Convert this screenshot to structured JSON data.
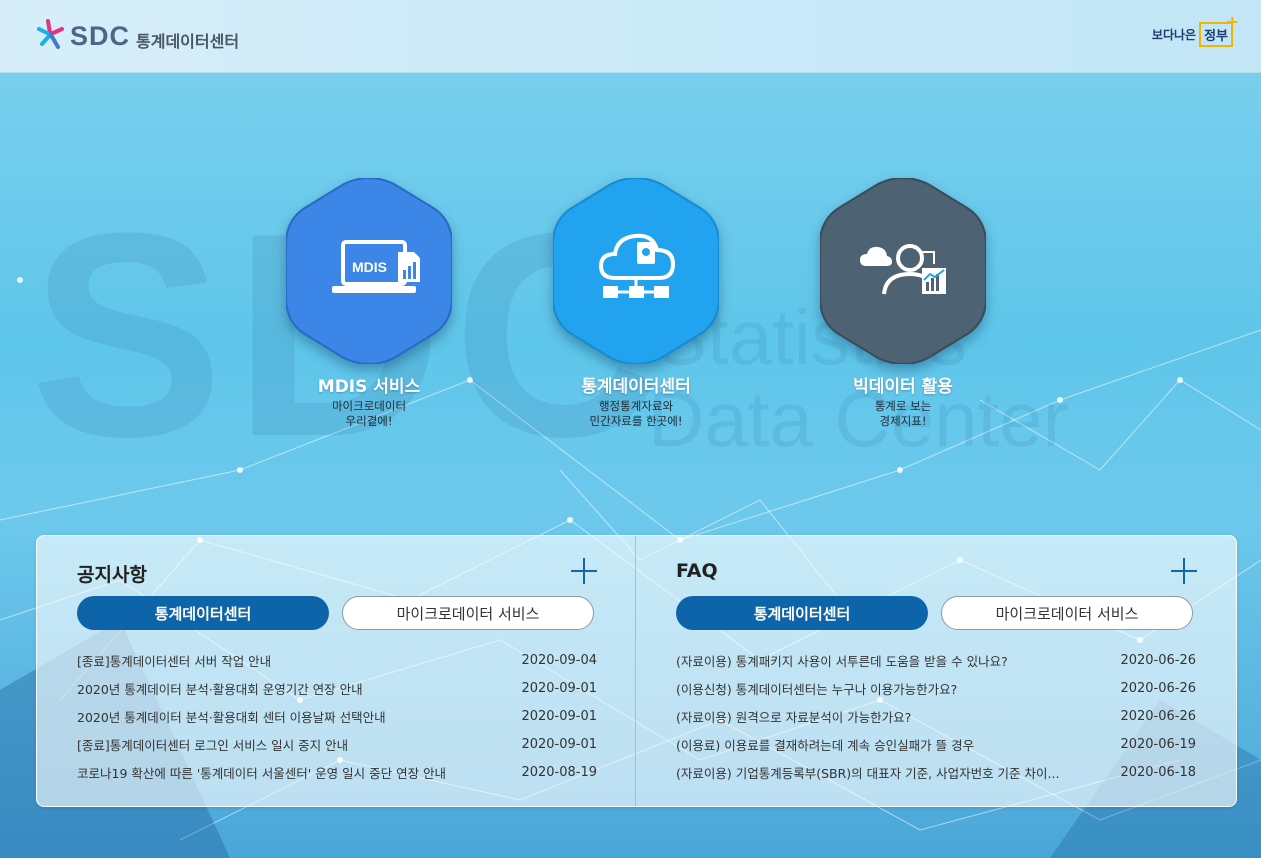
{
  "header": {
    "logo_mark": "SDC",
    "logo_name": "통계데이터센터",
    "gov_text": "보다나은",
    "gov_box": "정부"
  },
  "background": {
    "big_text": "SDC",
    "line1": "Statistics",
    "line2": "Data Center"
  },
  "services": [
    {
      "title": "MDIS 서비스",
      "desc1": "마이크로데이터",
      "desc2": "우리곁에!",
      "icon": "mdis-laptop-icon",
      "icon_text": "MDIS",
      "color": "#3b86e6"
    },
    {
      "title": "통계데이터센터",
      "desc1": "행정통계자료와",
      "desc2": "민간자료를 한곳에!",
      "icon": "cloud-network-icon",
      "color": "#21a3ef"
    },
    {
      "title": "빅데이터 활용",
      "desc1": "통계로 보는",
      "desc2": "경제지표!",
      "icon": "user-chart-icon",
      "color": "#4d6272"
    }
  ],
  "notice": {
    "title": "공지사항",
    "tab_active": "통계데이터센터",
    "tab_inactive": "마이크로데이터 서비스",
    "items": [
      {
        "text": "[종료]통계데이터센터 서버 작업 안내",
        "date": "2020-09-04"
      },
      {
        "text": "2020년 통계데이터 분석·활용대회 운영기간 연장 안내",
        "date": "2020-09-01"
      },
      {
        "text": "2020년 통계데이터 분석·활용대회 센터 이용날짜 선택안내",
        "date": "2020-09-01"
      },
      {
        "text": "[종료]통계데이터센터 로그인 서비스 일시 중지 안내",
        "date": "2020-09-01"
      },
      {
        "text": "코로나19 확산에 따른 '통계데이터 서울센터' 운영 일시 중단 연장 안내",
        "date": "2020-08-19"
      }
    ]
  },
  "faq": {
    "title": "FAQ",
    "tab_active": "통계데이터센터",
    "tab_inactive": "마이크로데이터 서비스",
    "items": [
      {
        "text": "(자료이용) 통계패키지 사용이 서투른데 도움을 받을 수 있나요?",
        "date": "2020-06-26"
      },
      {
        "text": "(이용신청) 통계데이터센터는 누구나 이용가능한가요?",
        "date": "2020-06-26"
      },
      {
        "text": "(자료이용) 원격으로 자료분석이 가능한가요?",
        "date": "2020-06-26"
      },
      {
        "text": "(이용료) 이용료를 결재하려는데 계속 승인실패가 뜰 경우",
        "date": "2020-06-19"
      },
      {
        "text": "(자료이용) 기업통계등록부(SBR)의 대표자 기준, 사업자번호 기준 차이...",
        "date": "2020-06-18"
      }
    ]
  }
}
